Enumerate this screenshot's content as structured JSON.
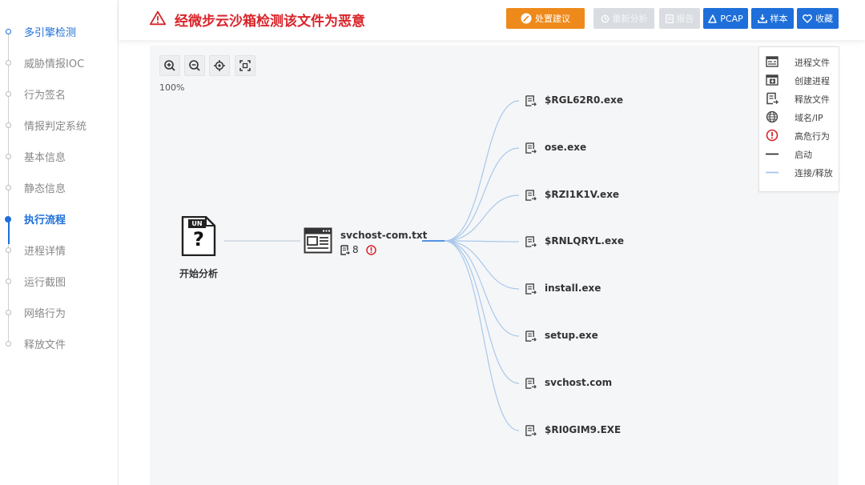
{
  "sidebar": {
    "items": [
      {
        "label": "多引擎检测"
      },
      {
        "label": "威胁情报IOC"
      },
      {
        "label": "行为签名"
      },
      {
        "label": "情报判定系统"
      },
      {
        "label": "基本信息"
      },
      {
        "label": "静态信息"
      },
      {
        "label": "执行流程"
      },
      {
        "label": "进程详情"
      },
      {
        "label": "运行截图"
      },
      {
        "label": "网络行为"
      },
      {
        "label": "释放文件"
      }
    ],
    "active_index": 6
  },
  "header": {
    "title": "经微步云沙箱检测该文件为恶意",
    "buttons": {
      "advice": "处置建议",
      "reanalyze": "重新分析",
      "report": "报告",
      "pcap": "PCAP",
      "sample": "样本",
      "favorite": "收藏"
    },
    "colors": {
      "danger": "#d9242b",
      "warning": "#ee8a1c",
      "primary": "#1e6fd9",
      "disabled": "#d9dde2"
    }
  },
  "toolbar": {
    "zoom_in_icon": "zoom-in-icon",
    "zoom_out_icon": "zoom-out-icon",
    "center_icon": "locate-icon",
    "fit_icon": "fit-screen-icon",
    "zoom_level": "100%"
  },
  "graph": {
    "start_node": {
      "badge": "UN",
      "glyph": "?",
      "label": "开始分析"
    },
    "process_node": {
      "name": "svchost-com.txt",
      "drop_count": "8"
    },
    "dropped_files": [
      {
        "name": "$RGL62R0.exe"
      },
      {
        "name": "ose.exe"
      },
      {
        "name": "$RZI1K1V.exe"
      },
      {
        "name": "$RNLQRYL.exe"
      },
      {
        "name": "install.exe"
      },
      {
        "name": "setup.exe"
      },
      {
        "name": "svchost.com"
      },
      {
        "name": "$RI0GIM9.EXE"
      }
    ]
  },
  "legend": {
    "items": [
      {
        "label": "进程文件",
        "icon": "process-file-icon"
      },
      {
        "label": "创建进程",
        "icon": "create-process-icon"
      },
      {
        "label": "释放文件",
        "icon": "drop-file-icon"
      },
      {
        "label": "域名/IP",
        "icon": "globe-icon"
      },
      {
        "label": "高危行为",
        "icon": "alert-icon"
      },
      {
        "label": "启动",
        "icon": "solid-line-icon"
      },
      {
        "label": "连接/释放",
        "icon": "light-line-icon"
      }
    ]
  }
}
